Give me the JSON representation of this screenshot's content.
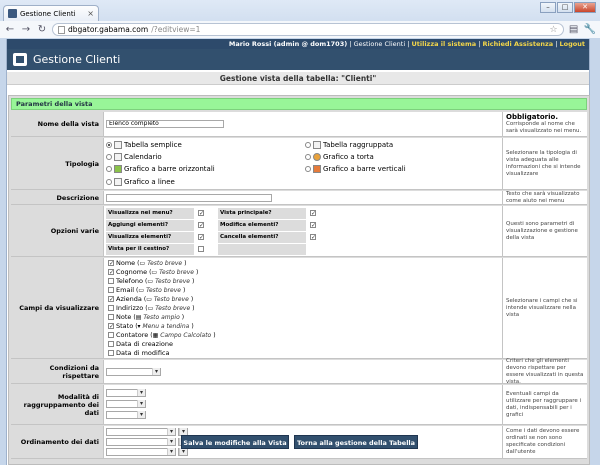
{
  "browser": {
    "tab_title": "Gestione Clienti",
    "url_host": "dbgator.gabama.com",
    "url_path": "/?editview=1",
    "window_buttons": [
      "–",
      "□",
      "✕"
    ]
  },
  "topbar": {
    "user": "Mario Rossi (admin @ dom1703)",
    "sep": "|",
    "app": "Gestione Clienti",
    "link1": "Utilizza il sistema",
    "link2": "Richiedi Assistenza",
    "logout": "Logout"
  },
  "header": {
    "title": "Gestione Clienti"
  },
  "page_title": "Gestione vista della tabella: \"Clienti\"",
  "section_title": "Parametri della vista",
  "nome": {
    "label": "Nome della vista",
    "value": "Elenco completo",
    "help_bold": "Obbligatorio.",
    "help": "Corrisponde al nome che sarà visualizzato nei menu."
  },
  "tipologia": {
    "label": "Tipologia",
    "options": [
      "Tabella semplice",
      "Tabella raggruppata",
      "Calendario",
      "Grafico a torta",
      "Grafico a barre orizzontali",
      "Grafico a barre verticali",
      "Grafico a linee"
    ],
    "help": "Selezionare la tipologia di vista adeguata alle informazioni che si intende visualizzare"
  },
  "descrizione": {
    "label": "Descrizione",
    "value": "",
    "help": "Testo che sarà visualizzato come aiuto nei menu"
  },
  "opzioni": {
    "label": "Opzioni varie",
    "items": [
      "Visualizza nei menu?",
      "Aggiungi elementi?",
      "Visualizza elementi?",
      "Vista per il cestino?",
      "Vista principale?",
      "Modifica elementi?",
      "Cancella elementi?"
    ],
    "help": "Questi sono parametri di visualizzazione e gestione della vista"
  },
  "campi": {
    "label": "Campi da visualizzare",
    "help": "Selezionare i campi che si intende visualizzare nella vista",
    "fields": [
      {
        "name": "Nome",
        "type": "Testo breve"
      },
      {
        "name": "Cognome",
        "type": "Testo breve"
      },
      {
        "name": "Telefono",
        "type": "Testo breve"
      },
      {
        "name": "Email",
        "type": "Testo breve"
      },
      {
        "name": "Azienda",
        "type": "Testo breve"
      },
      {
        "name": "Indirizzo",
        "type": "Testo breve"
      },
      {
        "name": "Note",
        "type": "Testo ampio"
      },
      {
        "name": "Stato",
        "type": "Menu a tendina"
      },
      {
        "name": "Contatore",
        "type": "Campo Calcolato"
      },
      {
        "name": "Data di creazione",
        "type": ""
      },
      {
        "name": "Data di modifica",
        "type": ""
      }
    ]
  },
  "condizioni": {
    "label": "Condizioni da rispettare",
    "help": "Criteri che gli elementi devono rispettare per essere visualizzati in questa vista."
  },
  "raggruppamento": {
    "label": "Modalità di raggruppamento dei dati",
    "help": "Eventuali campi da utilizzare per raggruppare i dati, indispensabili per i grafici"
  },
  "ordinamento": {
    "label": "Ordinamento dei dati",
    "help": "Come i dati devono essere ordinati se non sono specificate condizioni dall'utente"
  },
  "buttons": {
    "save": "Salva le modifiche alla Vista",
    "back": "Torna alla gestione della Tabella"
  }
}
